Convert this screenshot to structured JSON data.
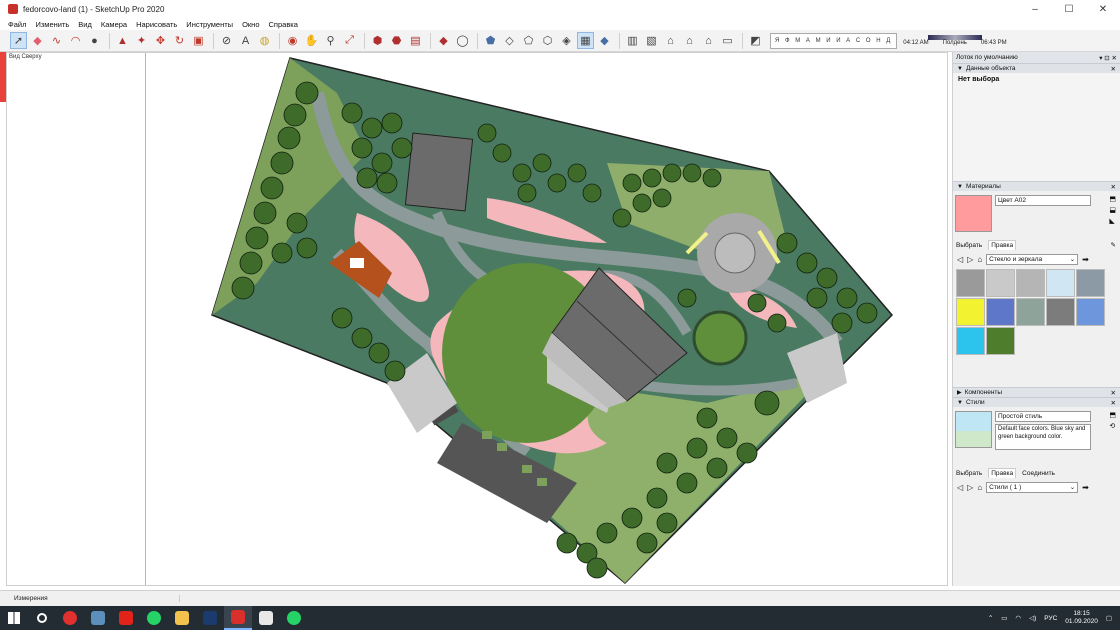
{
  "window": {
    "title": "fedorcovo-land (1) - SketchUp Pro 2020",
    "minimize": "–",
    "maximize": "☐",
    "close": "✕"
  },
  "menu": [
    "Файл",
    "Изменить",
    "Вид",
    "Камера",
    "Нарисовать",
    "Инструменты",
    "Окно",
    "Справка"
  ],
  "toolbar": {
    "shadow_months": "Я Ф М А М И И А С О Н Д",
    "time_start": "04:12 AM",
    "time_mid": "Полдень",
    "time_end": "06:43 PM"
  },
  "viewport": {
    "scene_label": "Вид Сверху"
  },
  "tray": {
    "title": "Лоток по умолчанию",
    "entity_info": {
      "header": "Данные объекта",
      "no_selection": "Нет выбора"
    },
    "materials": {
      "header": "Материалы",
      "name": "Цвет A02",
      "swatch_color": "#ff9b9c",
      "tab_select": "Выбрать",
      "tab_edit": "Правка",
      "library": "Стекло и зеркала",
      "swatches": [
        "#9a9a9a",
        "#c9c9c9",
        "#b5b5b5",
        "#d0e6f2",
        "#8c9aa6",
        "#f2f230",
        "#5e77c8",
        "#8ea39a",
        "#7c7c7c",
        "#6e96dd",
        "#2cc4ec",
        "#4e7d2c"
      ]
    },
    "components": {
      "header": "Компоненты"
    },
    "styles": {
      "header": "Стили",
      "name": "Простой стиль",
      "description": "Default face colors. Blue sky and green background color.",
      "tab_select": "Выбрать",
      "tab_edit": "Правка",
      "tab_mix": "Соединить",
      "library": "Стили ( 1 )"
    }
  },
  "status": {
    "measurements": "Измерения"
  },
  "taskbar": {
    "lang": "РУС",
    "time": "18:15",
    "date": "01.09.2020"
  }
}
